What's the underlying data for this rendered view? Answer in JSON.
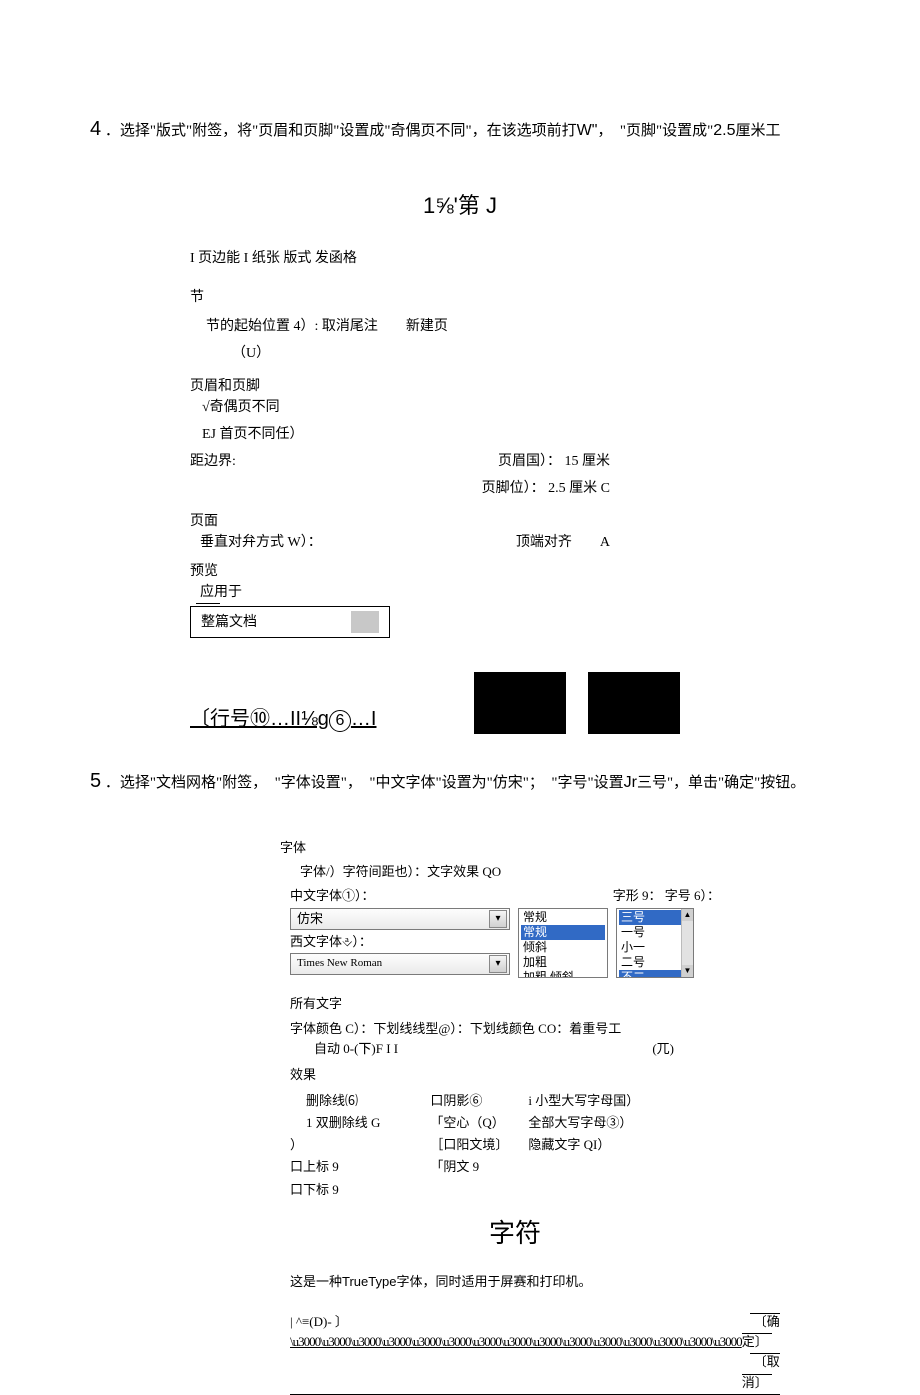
{
  "step4": {
    "num": "4",
    "text_a": " ．选择\"版式\"附签，将\"页眉和页脚\"设置成\"奇偶页不同\"，在该选项前打",
    "text_w": "W\"",
    "text_b": "，　\"页脚\"设置成\"",
    "text_c": "2.5",
    "text_d": "厘米工"
  },
  "formula": "1⅝'第 J",
  "dialog1": {
    "tabs": "I 页边能 I 纸张 版式 发函格",
    "section_lbl": "节",
    "section_start": "节的起始位置 4）: 取消尾注　　新建页",
    "section_u": "（U）",
    "hf_title": "页眉和页脚",
    "hf_odd": "√奇偶页不同",
    "hf_first": "EJ 首页不同任）",
    "margin_lbl": "距边界:",
    "header_lbl": "页眉国）：",
    "header_val": "15 厘米",
    "footer_lbl": "页脚位）：",
    "footer_val": "2.5 厘米 C",
    "page_lbl": "页面",
    "valign_lbl": "垂直对弁方式 W）：",
    "valign_val": "顶端对齐　　A",
    "preview": "预览",
    "applyto": "应用于",
    "applyto_val": "整篇文档",
    "line_num": "〔行号⑩…II⅛g",
    "circ6": "6",
    "line_num_b": "…I"
  },
  "step5": {
    "num": "5",
    "text_a": " ．选择\"文档网格\"附签，　\"字体设置\"，　\"中文字体\"设置为\"仿宋\"；　\"字号\"设置",
    "text_jr": "Jr",
    "text_b": "三号\"，单击\"确定\"按钮。"
  },
  "dialog2": {
    "hdr": "字体",
    "tabs": "字体/）字符间距也）：文字效果 QO",
    "cjk_lbl": "中文字体①）：",
    "style_lbl": "字形 9：",
    "size_lbl": "字号 6）：",
    "cjk_val": "仿宋",
    "latin_lbl": "西文字体⎀）：",
    "latin_val": "Times New Roman",
    "style_sel": "常规",
    "style_opts": [
      "常规",
      "倾斜",
      "加粗",
      "加粗  倾斜"
    ],
    "size_sel": "三号",
    "size_opts": [
      "三号",
      "一号",
      "小一",
      "二号",
      "不二"
    ],
    "alltext": "所有文字",
    "colors": "字体颜色 C）：下划线线型@）：下划线颜色 CO：着重号工",
    "auto": "自动 0-(㆘)F I I",
    "auto_r": "(兀)",
    "fx": "效果",
    "fx_col1": [
      "删除线⑹",
      "1 双删除线 G"
    ],
    "fx_rp": "）",
    "fx_col1b": [
      "口上标 9",
      "口下标 9"
    ],
    "fx_col2": [
      "口阴影⑥",
      "「空心（Q）",
      "［口阳文境〕",
      "「阴文 9"
    ],
    "fx_col3": [
      "i 小型大写字母国）",
      "全部大写字母③）",
      "隐藏文字 QI）"
    ],
    "preview": "字符",
    "desc": "这是一种",
    "desc_tt": "TrueType",
    "desc_b": "字体，同时适用于屏赛和打印机。",
    "btn_default": "|  ^≡(D)- 〕",
    "btn_ok": "〔确定〕",
    "btn_cancel": "〔取消〕"
  }
}
